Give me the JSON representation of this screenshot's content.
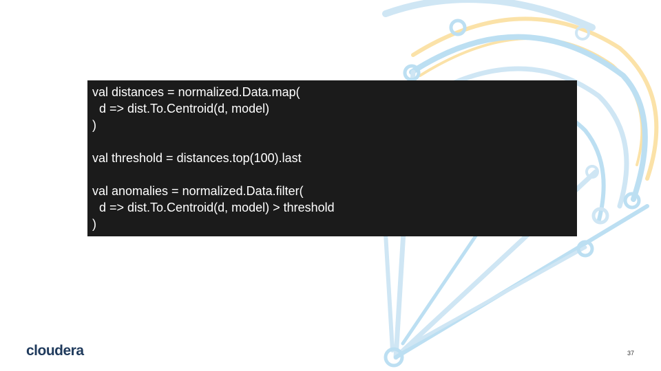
{
  "code": {
    "lines": [
      "val distances = normalized.Data.map(",
      "  d => dist.To.Centroid(d, model)",
      ")",
      "",
      "val threshold = distances.top(100).last",
      "",
      "val anomalies = normalized.Data.filter(",
      "  d => dist.To.Centroid(d, model) > threshold",
      ")"
    ]
  },
  "footer": {
    "logo_text": "cloudera",
    "page_number": "37"
  },
  "colors": {
    "code_background": "#1b1b1b",
    "code_text": "#ffffff",
    "decor_blue": "#bcdff2",
    "decor_orange": "#fbe2a8",
    "logo": "#1f3a5c"
  }
}
